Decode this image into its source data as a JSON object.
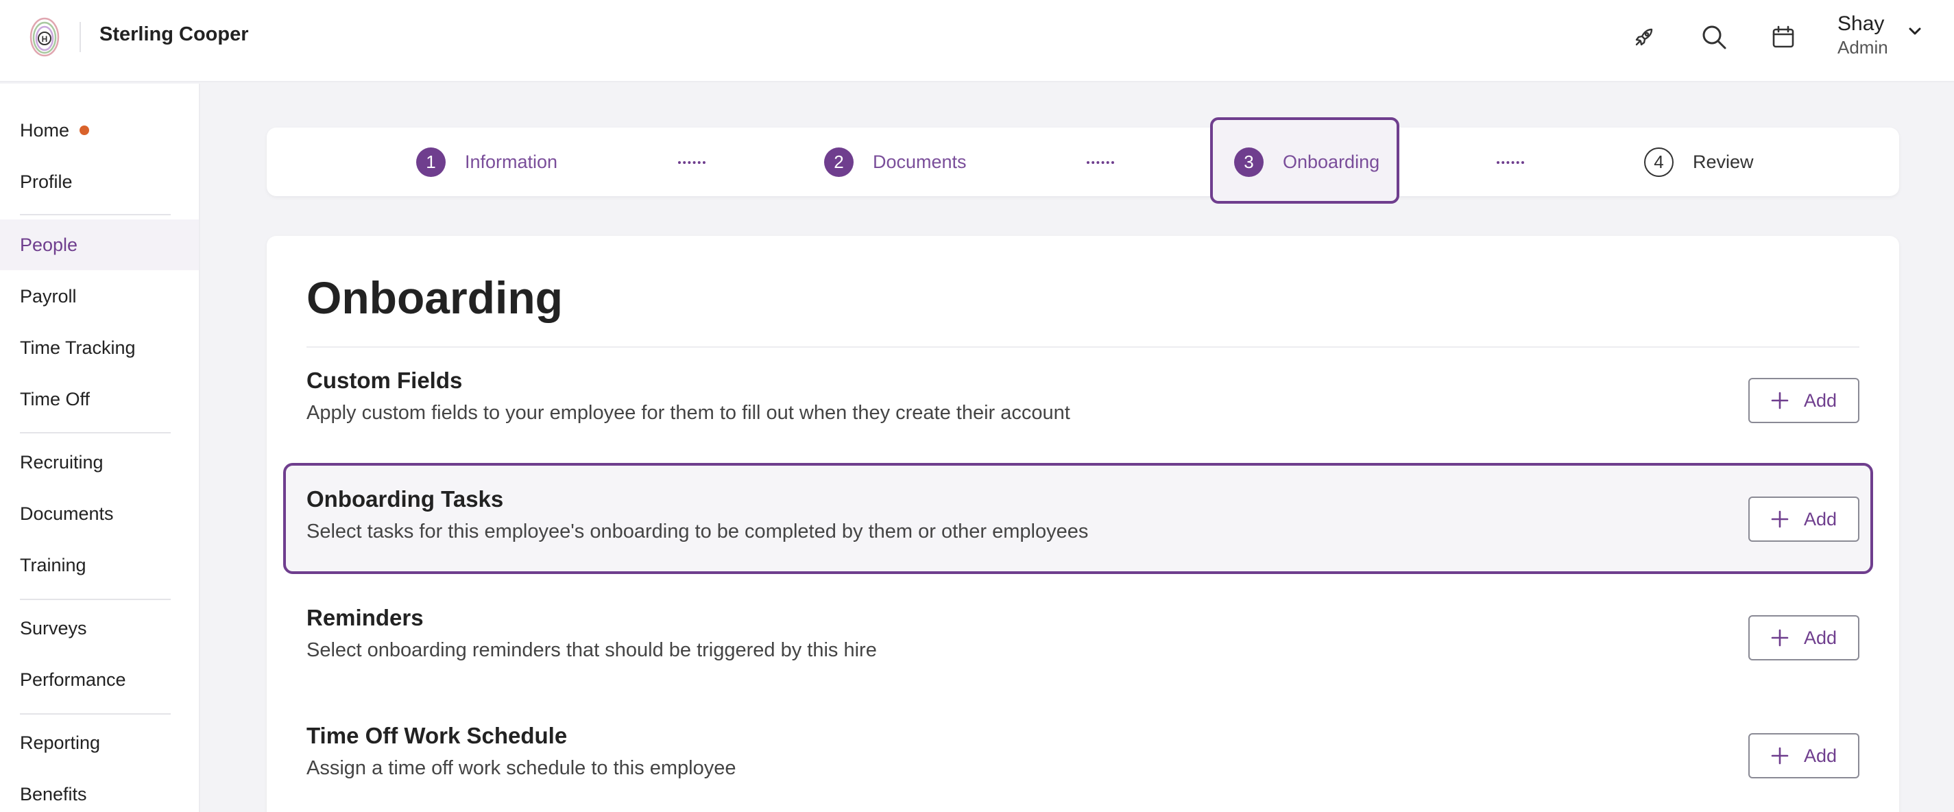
{
  "header": {
    "company_name": "Sterling Cooper",
    "user_name": "Shay",
    "user_role": "Admin",
    "icons": [
      "rocket-icon",
      "search-icon",
      "calendar-icon",
      "chevron-down-icon"
    ]
  },
  "sidebar": {
    "items": [
      {
        "label": "Home",
        "badge": true
      },
      {
        "label": "Profile"
      },
      {
        "label": "People",
        "active": true
      },
      {
        "label": "Payroll"
      },
      {
        "label": "Time Tracking"
      },
      {
        "label": "Time Off"
      },
      {
        "label": "Recruiting"
      },
      {
        "label": "Documents"
      },
      {
        "label": "Training"
      },
      {
        "label": "Surveys"
      },
      {
        "label": "Performance"
      },
      {
        "label": "Reporting"
      },
      {
        "label": "Benefits"
      }
    ]
  },
  "stepper": {
    "steps": [
      {
        "number": "1",
        "label": "Information"
      },
      {
        "number": "2",
        "label": "Documents"
      },
      {
        "number": "3",
        "label": "Onboarding",
        "current": true
      },
      {
        "number": "4",
        "label": "Review"
      }
    ]
  },
  "main": {
    "title": "Onboarding",
    "add_label": "Add",
    "sections": [
      {
        "title": "Custom Fields",
        "description": "Apply custom fields to your employee for them to fill out when they create their account"
      },
      {
        "title": "Onboarding Tasks",
        "description": "Select tasks for this employee's onboarding to be completed by them or other employees",
        "highlighted": true
      },
      {
        "title": "Reminders",
        "description": "Select onboarding reminders that should be triggered by this hire"
      },
      {
        "title": "Time Off Work Schedule",
        "description": "Assign a time off work schedule to this employee"
      }
    ]
  },
  "colors": {
    "accent": "#6f3e8e",
    "badge": "#d9622b",
    "background": "#f3f3f6"
  }
}
